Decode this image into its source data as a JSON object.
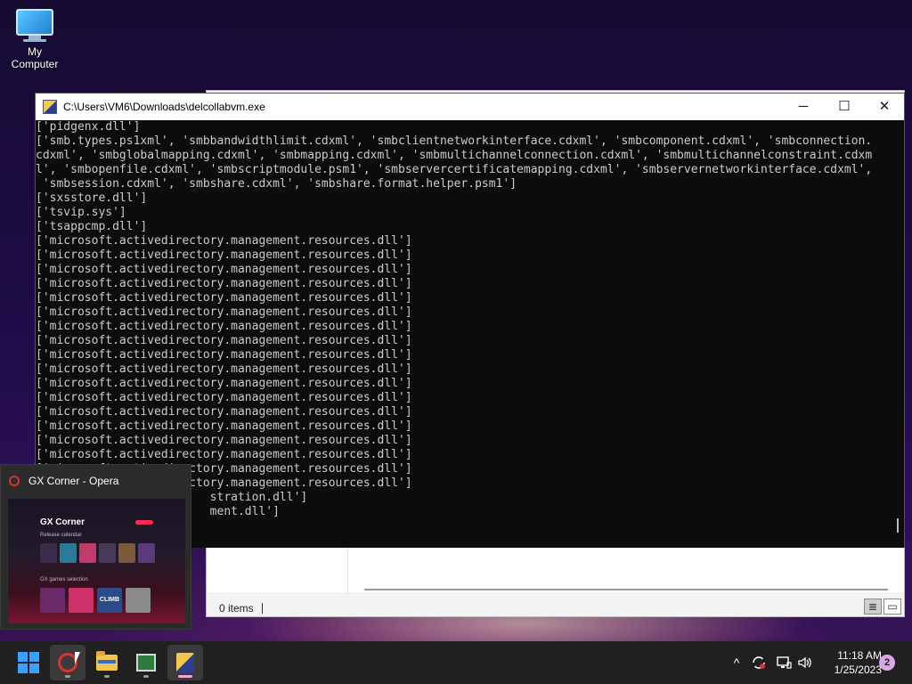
{
  "desktop": {
    "icons": [
      {
        "label": "My Computer",
        "icon": "monitor-icon"
      }
    ]
  },
  "explorer": {
    "status": "0 items",
    "views": [
      "details-view-icon",
      "large-icons-view-icon"
    ]
  },
  "console": {
    "title": "C:\\Users\\VM6\\Downloads\\delcollabvm.exe",
    "controls": {
      "minimize": "─",
      "maximize": "☐",
      "close": "✕"
    },
    "lines": [
      "['pidgenx.dll']",
      "['smb.types.ps1xml', 'smbbandwidthlimit.cdxml', 'smbclientnetworkinterface.cdxml', 'smbcomponent.cdxml', 'smbconnection.",
      "cdxml', 'smbglobalmapping.cdxml', 'smbmapping.cdxml', 'smbmultichannelconnection.cdxml', 'smbmultichannelconstraint.cdxm",
      "l', 'smbopenfile.cdxml', 'smbscriptmodule.psm1', 'smbservercertificatemapping.cdxml', 'smbservernetworkinterface.cdxml',",
      " 'smbsession.cdxml', 'smbshare.cdxml', 'smbshare.format.helper.psm1']",
      "['sxsstore.dll']",
      "['tsvip.sys']",
      "['tsappcmp.dll']",
      "['microsoft.activedirectory.management.resources.dll']",
      "['microsoft.activedirectory.management.resources.dll']",
      "['microsoft.activedirectory.management.resources.dll']",
      "['microsoft.activedirectory.management.resources.dll']",
      "['microsoft.activedirectory.management.resources.dll']",
      "['microsoft.activedirectory.management.resources.dll']",
      "['microsoft.activedirectory.management.resources.dll']",
      "['microsoft.activedirectory.management.resources.dll']",
      "['microsoft.activedirectory.management.resources.dll']",
      "['microsoft.activedirectory.management.resources.dll']",
      "['microsoft.activedirectory.management.resources.dll']",
      "['microsoft.activedirectory.management.resources.dll']",
      "['microsoft.activedirectory.management.resources.dll']",
      "['microsoft.activedirectory.management.resources.dll']",
      "['microsoft.activedirectory.management.resources.dll']",
      "['microsoft.activedirectory.management.resources.dll']",
      "['microsoft.activedirectory.management.resources.dll']",
      "['microsoft.activedirectory.management.resources.dll']",
      "                         stration.dll']",
      "                         ment.dll']"
    ]
  },
  "preview": {
    "title": "GX Corner - Opera",
    "thumbnail": {
      "heading": "GX Corner",
      "section1": "Release calendar",
      "section2": "GX games selection",
      "tile_label": "CLIMB"
    }
  },
  "taskbar": {
    "apps": [
      {
        "name": "start-button",
        "icon": "windows-logo-icon",
        "running": false
      },
      {
        "name": "opera-button",
        "icon": "opera-icon",
        "running": true
      },
      {
        "name": "file-explorer-button",
        "icon": "folder-icon",
        "running": true
      },
      {
        "name": "task-manager-button",
        "icon": "task-manager-icon",
        "running": true
      },
      {
        "name": "python-exe-button",
        "icon": "python-exe-icon",
        "running": true,
        "focused": true
      }
    ],
    "tray": {
      "chevron": "^",
      "clock_time": "11:18 AM",
      "clock_date": "1/25/2023",
      "notifications": "2"
    }
  },
  "colors": {
    "console_bg": "#0c0c0c",
    "console_fg": "#cccccc",
    "taskbar_bg": "#202020",
    "accent_pink": "#f0a8d8"
  }
}
